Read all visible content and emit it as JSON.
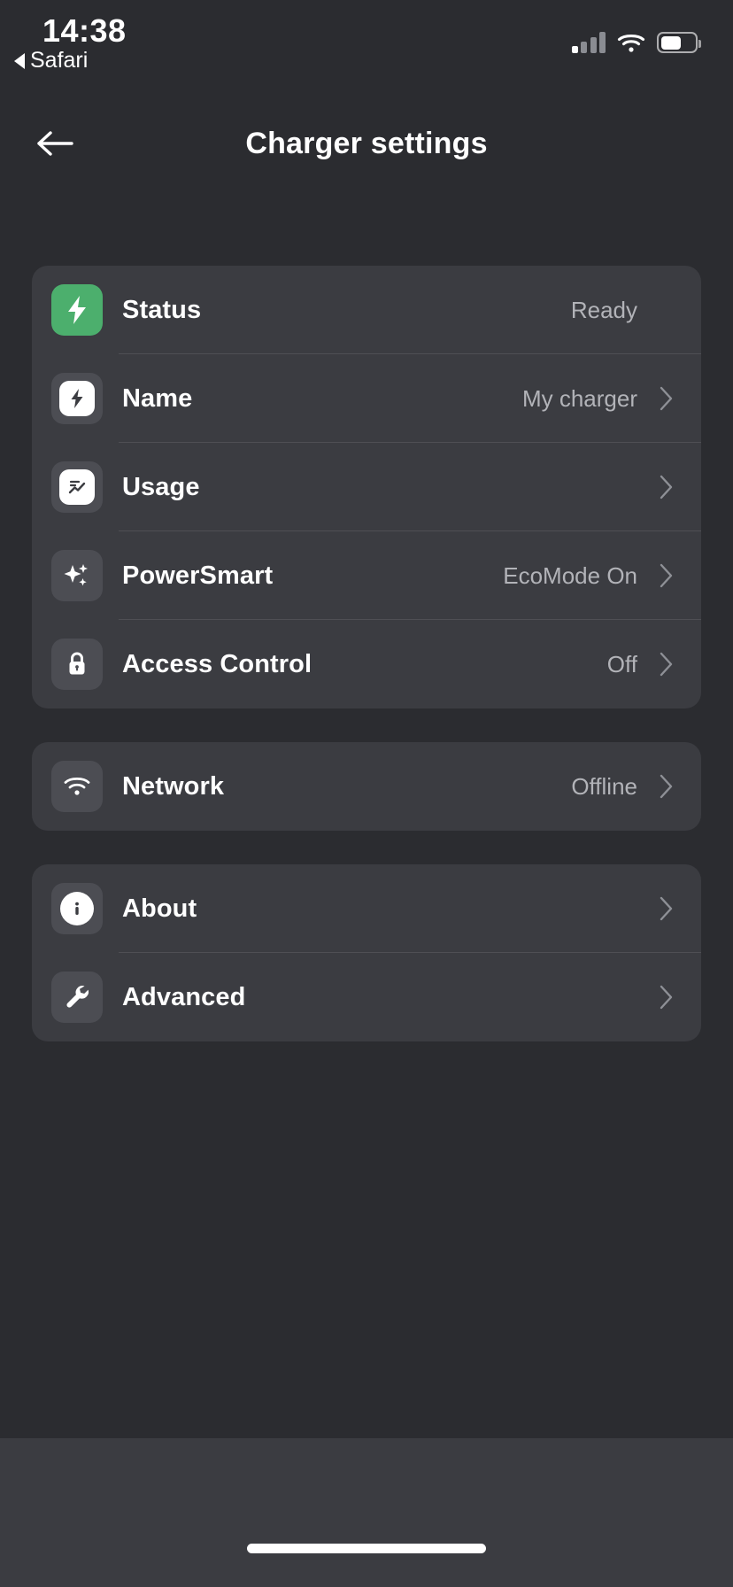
{
  "status_bar": {
    "time": "14:38",
    "return_app": "Safari",
    "signal_bars_total": 4,
    "signal_bars_active": 1,
    "wifi": "wifi-icon",
    "battery_percent": 62
  },
  "header": {
    "title": "Charger settings",
    "back_icon": "arrow-left-icon"
  },
  "sections": [
    {
      "id": "device",
      "rows": [
        {
          "label": "Status",
          "value": "Ready",
          "icon": "bolt-icon",
          "chevron": false,
          "accent": "#4caf6d"
        },
        {
          "label": "Name",
          "value": "My charger",
          "icon": "bolt-badge-icon",
          "chevron": true
        },
        {
          "label": "Usage",
          "value": "",
          "icon": "chart-icon",
          "chevron": true
        },
        {
          "label": "PowerSmart",
          "value": "EcoMode On",
          "icon": "sparkles-icon",
          "chevron": true
        },
        {
          "label": "Access Control",
          "value": "Off",
          "icon": "lock-icon",
          "chevron": true
        }
      ]
    },
    {
      "id": "connectivity",
      "rows": [
        {
          "label": "Network",
          "value": "Offline",
          "icon": "wifi-icon",
          "chevron": true
        }
      ]
    },
    {
      "id": "system",
      "rows": [
        {
          "label": "About",
          "value": "",
          "icon": "info-icon",
          "chevron": true
        },
        {
          "label": "Advanced",
          "value": "",
          "icon": "wrench-icon",
          "chevron": true
        }
      ]
    }
  ],
  "colors": {
    "page_background": "#2b2c30",
    "card_background": "#3b3c41",
    "tile_background": "#4c4d53",
    "accent_green": "#4caf6d",
    "value_text": "#b2b3b8",
    "label_text": "#ffffff"
  }
}
